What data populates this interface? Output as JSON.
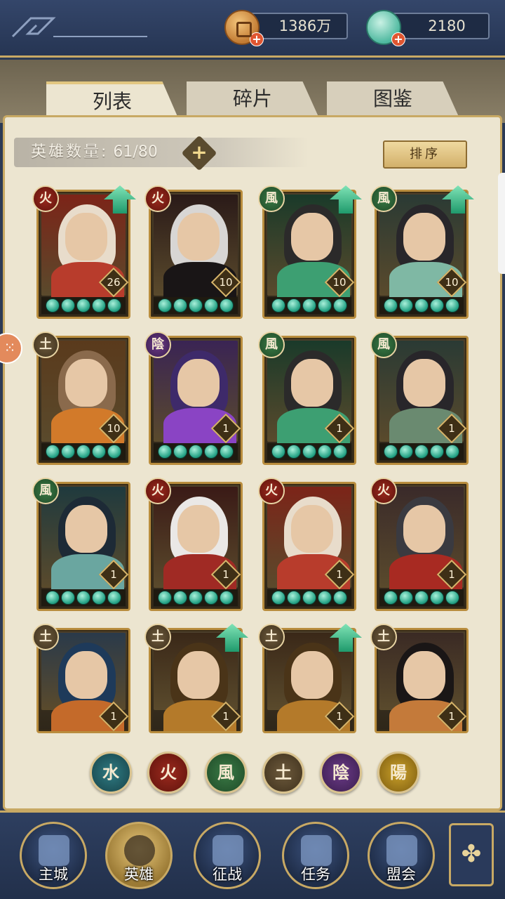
{
  "currency": {
    "coins": "1386万",
    "jade": "2180"
  },
  "tabs": [
    {
      "label": "列表",
      "active": true
    },
    {
      "label": "碎片",
      "active": false
    },
    {
      "label": "图鉴",
      "active": false
    }
  ],
  "hero_count": {
    "label": "英雄数量:",
    "value": "61/80"
  },
  "sort_label": "排序",
  "element_glyphs": {
    "fire": "火",
    "wind": "風",
    "earth": "土",
    "yin": "陰",
    "yang": "陽",
    "water": "水"
  },
  "heroes": [
    {
      "element": "fire",
      "level": "26",
      "upgrade": true,
      "stars": 5,
      "palette": [
        "#7c2418",
        "#e8dccb",
        "#b83c2c"
      ]
    },
    {
      "element": "fire",
      "level": "10",
      "upgrade": false,
      "stars": 5,
      "palette": [
        "#2a1a18",
        "#d8d6d4",
        "#191516"
      ]
    },
    {
      "element": "wind",
      "level": "10",
      "upgrade": true,
      "stars": 5,
      "palette": [
        "#1a3a2a",
        "#2b2a2a",
        "#3d9f72"
      ]
    },
    {
      "element": "wind",
      "level": "10",
      "upgrade": true,
      "stars": 5,
      "palette": [
        "#2a3a34",
        "#28262a",
        "#7fb8a4"
      ]
    },
    {
      "element": "earth",
      "level": "10",
      "upgrade": false,
      "stars": 5,
      "palette": [
        "#5a3a1c",
        "#8a6a4c",
        "#d27a2a"
      ]
    },
    {
      "element": "yin",
      "level": "1",
      "upgrade": false,
      "stars": 5,
      "palette": [
        "#3a2454",
        "#3e2a6a",
        "#8a44c4"
      ]
    },
    {
      "element": "wind",
      "level": "1",
      "upgrade": false,
      "stars": 5,
      "palette": [
        "#1a3a2a",
        "#2b2a2a",
        "#3d9f72"
      ]
    },
    {
      "element": "wind",
      "level": "1",
      "upgrade": false,
      "stars": 5,
      "palette": [
        "#2a3a34",
        "#28262a",
        "#6a8a70"
      ]
    },
    {
      "element": "wind",
      "level": "1",
      "upgrade": false,
      "stars": 5,
      "palette": [
        "#1f3a3e",
        "#1d2a36",
        "#6aa6a0"
      ]
    },
    {
      "element": "fire",
      "level": "1",
      "upgrade": false,
      "stars": 5,
      "palette": [
        "#3a1a16",
        "#eae8e6",
        "#a02a24"
      ]
    },
    {
      "element": "fire",
      "level": "1",
      "upgrade": false,
      "stars": 5,
      "palette": [
        "#7c2418",
        "#e8dccb",
        "#b83c2c"
      ]
    },
    {
      "element": "fire",
      "level": "1",
      "upgrade": false,
      "stars": 5,
      "palette": [
        "#3a2a2a",
        "#3a3a40",
        "#a82a22"
      ]
    },
    {
      "element": "earth",
      "level": "1",
      "upgrade": false,
      "stars": 0,
      "palette": [
        "#2a3a4a",
        "#1e3a5a",
        "#c46a2a"
      ]
    },
    {
      "element": "earth",
      "level": "1",
      "upgrade": true,
      "stars": 0,
      "palette": [
        "#3a2818",
        "#4a3418",
        "#b47a2a"
      ]
    },
    {
      "element": "earth",
      "level": "1",
      "upgrade": true,
      "stars": 0,
      "palette": [
        "#3a2818",
        "#4a3418",
        "#b47a2a"
      ]
    },
    {
      "element": "earth",
      "level": "1",
      "upgrade": false,
      "stars": 0,
      "palette": [
        "#3a2a24",
        "#1a1616",
        "#c47a3a"
      ]
    }
  ],
  "filters": [
    "water",
    "fire",
    "wind",
    "earth",
    "yin",
    "yang"
  ],
  "nav": [
    {
      "label": "主城",
      "icon": "city-gate-icon",
      "active": false
    },
    {
      "label": "英雄",
      "icon": "hero-portrait-icon",
      "active": true
    },
    {
      "label": "征战",
      "icon": "battle-icon",
      "active": false
    },
    {
      "label": "任务",
      "icon": "scroll-icon",
      "active": false
    },
    {
      "label": "盟会",
      "icon": "alliance-icon",
      "active": false
    }
  ],
  "menu_icon": "clover-menu-icon"
}
